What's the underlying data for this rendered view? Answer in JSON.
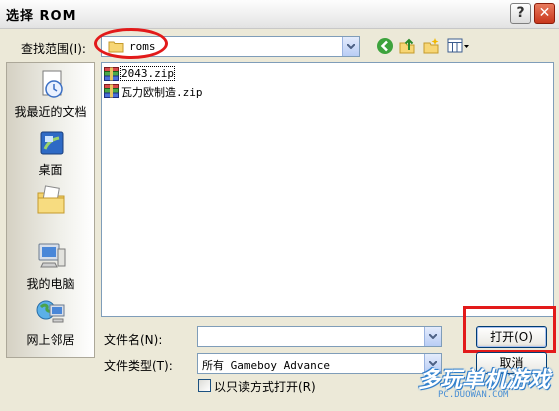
{
  "window": {
    "title": "选择 ROM",
    "help_label": "?",
    "close_label": "✕"
  },
  "lookin": {
    "label": "查找范围(I):",
    "value": "roms",
    "icon": "folder-icon"
  },
  "toolbar": {
    "icons": [
      "back-icon",
      "up-folder-icon",
      "new-folder-icon",
      "view-menu-icon"
    ]
  },
  "places": [
    {
      "label": "我最近的文档",
      "icon": "recent-documents-icon"
    },
    {
      "label": "桌面",
      "icon": "desktop-icon"
    },
    {
      "label": "",
      "icon": "my-documents-icon"
    },
    {
      "label": "我的电脑",
      "icon": "my-computer-icon"
    },
    {
      "label": "网上邻居",
      "icon": "network-places-icon"
    }
  ],
  "files": [
    {
      "name": "2043.zip",
      "icon": "zip-archive-icon",
      "selected": true
    },
    {
      "name": "瓦力欧制造.zip",
      "icon": "zip-archive-icon",
      "selected": false
    }
  ],
  "filename": {
    "label": "文件名(N):",
    "value": ""
  },
  "filetype": {
    "label": "文件类型(T):",
    "value": "所有 Gameboy Advance"
  },
  "open_button": "打开(O)",
  "cancel_button": "取消",
  "readonly_label": "以只读方式打开(R)",
  "watermark": {
    "main": "多玩单机游戏",
    "sub": "PC.DUOWAN.COM"
  },
  "colors": {
    "highlight_red": "#e21a1a",
    "dialog_bg": "#ece9d8",
    "border_blue": "#7f9db9"
  }
}
